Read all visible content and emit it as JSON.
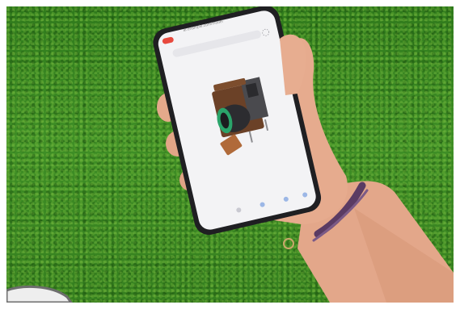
{
  "photo": {
    "subject": "hand-holding-phone",
    "background": "grass",
    "colors": {
      "grass": "#3f8f26",
      "skin": "#e2a888",
      "phone_body": "#1f1f22",
      "screen": "#f3f3f5",
      "record_badge": "#e8493d",
      "bracelet": "#5a3b63"
    }
  },
  "phone": {
    "url": "ar.example.com/model"
  }
}
